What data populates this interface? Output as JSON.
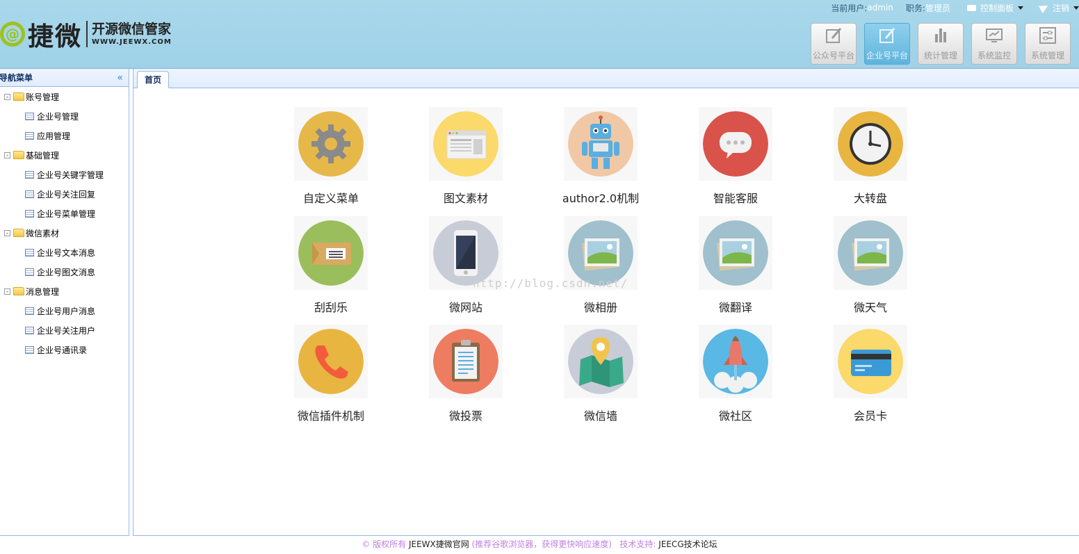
{
  "brand": {
    "at": "@",
    "name": "捷微",
    "cn": "开源微信管家",
    "en": "WWW.JEEWX.COM"
  },
  "topbar": {
    "user_key": "当前用户:",
    "user_val": "admin",
    "role_key": "职务:",
    "role_val": "管理员",
    "control_panel": "控制面板",
    "logout": "注销"
  },
  "platforms": [
    {
      "label": "公众号平台",
      "icon": "edit-icon",
      "active": false
    },
    {
      "label": "企业号平台",
      "icon": "edit-icon",
      "active": true
    },
    {
      "label": "统计管理",
      "icon": "bar-chart-icon",
      "active": false
    },
    {
      "label": "系统监控",
      "icon": "monitor-icon",
      "active": false
    },
    {
      "label": "系统管理",
      "icon": "settings-icon",
      "active": false
    }
  ],
  "sidebar": {
    "title": "导航菜单",
    "groups": [
      {
        "label": "账号管理",
        "items": [
          "企业号管理",
          "应用管理"
        ]
      },
      {
        "label": "基础管理",
        "items": [
          "企业号关键字管理",
          "企业号关注回复",
          "企业号菜单管理"
        ]
      },
      {
        "label": "微信素材",
        "items": [
          "企业号文本消息",
          "企业号图文消息"
        ]
      },
      {
        "label": "消息管理",
        "items": [
          "企业号用户消息",
          "企业号关注用户",
          "企业号通讯录"
        ]
      }
    ]
  },
  "tabs": {
    "home": "首页"
  },
  "tiles": [
    {
      "label": "自定义菜单",
      "icon": "gear-icon",
      "color": "#e6b84a"
    },
    {
      "label": "图文素材",
      "icon": "webpage-icon",
      "color": "#fbd96a"
    },
    {
      "label": "author2.0机制",
      "icon": "robot-icon",
      "color": "#f0c8a6"
    },
    {
      "label": "智能客服",
      "icon": "chat-bubble-icon",
      "color": "#d9534a"
    },
    {
      "label": "大转盘",
      "icon": "clock-icon",
      "color": "#e8b540"
    },
    {
      "label": "刮刮乐",
      "icon": "ticket-icon",
      "color": "#9bbe5c"
    },
    {
      "label": "微网站",
      "icon": "phone-icon",
      "color": "#c8ccd6"
    },
    {
      "label": "微相册",
      "icon": "picture-icon",
      "color": "#9fc0cc"
    },
    {
      "label": "微翻译",
      "icon": "picture-icon",
      "color": "#9fc0cc"
    },
    {
      "label": "微天气",
      "icon": "picture-icon",
      "color": "#9fc0cc"
    },
    {
      "label": "微信插件机制",
      "icon": "telephone-icon",
      "color": "#e8b540"
    },
    {
      "label": "微投票",
      "icon": "clipboard-icon",
      "color": "#ee7c60"
    },
    {
      "label": "微信墙",
      "icon": "map-pin-icon",
      "color": "#c8ccd6"
    },
    {
      "label": "微社区",
      "icon": "rocket-icon",
      "color": "#59b8e4"
    },
    {
      "label": "会员卡",
      "icon": "credit-card-icon",
      "color": "#fbd96a"
    }
  ],
  "watermark": "http://blog.csdn.net/",
  "footer": {
    "copyright": "© 版权所有",
    "site": "JEEWX捷微官网",
    "tip": "(推荐谷歌浏览器，获得更快响应速度)",
    "support_label": "技术支持:",
    "support": "JEECG技术论坛"
  }
}
